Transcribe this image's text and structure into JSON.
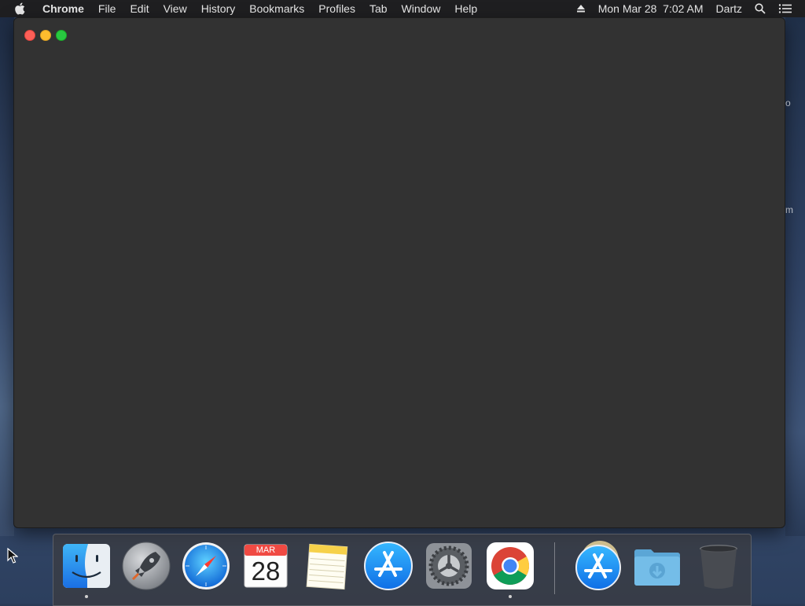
{
  "menubar": {
    "apple_icon": "apple-icon",
    "app_name": "Chrome",
    "items": [
      "File",
      "Edit",
      "View",
      "History",
      "Bookmarks",
      "Profiles",
      "Tab",
      "Window",
      "Help"
    ],
    "right": {
      "eject_icon": "eject-icon",
      "datetime": "Mon Mar 28  7:02 AM",
      "user": "Dartz",
      "search_icon": "spotlight-search-icon",
      "control_icon": "notification-center-icon"
    }
  },
  "desktop_edge_text": {
    "a": "o",
    "b": "m"
  },
  "dock": {
    "items": [
      {
        "name": "Finder",
        "icon": "finder-icon",
        "running": true
      },
      {
        "name": "Launchpad",
        "icon": "launchpad-icon",
        "running": false
      },
      {
        "name": "Safari",
        "icon": "safari-icon",
        "running": false
      },
      {
        "name": "Calendar",
        "icon": "calendar-icon",
        "running": false,
        "month": "MAR",
        "day": "28"
      },
      {
        "name": "Notes",
        "icon": "notes-icon",
        "running": false
      },
      {
        "name": "App Store",
        "icon": "app-store-icon",
        "running": false
      },
      {
        "name": "System Preferences",
        "icon": "system-preferences-icon",
        "running": false
      },
      {
        "name": "Google Chrome",
        "icon": "chrome-icon",
        "running": true
      },
      {
        "name": "Applications",
        "icon": "app-store-stack-icon",
        "running": false
      },
      {
        "name": "Downloads",
        "icon": "downloads-folder-icon",
        "running": false
      },
      {
        "name": "Trash",
        "icon": "trash-icon",
        "running": false
      }
    ]
  },
  "colors": {
    "menubar_bg": "#1f1f21",
    "window_bg": "#323232",
    "close": "#fd5f57",
    "minimize": "#febc2e",
    "maximize": "#28c840"
  }
}
